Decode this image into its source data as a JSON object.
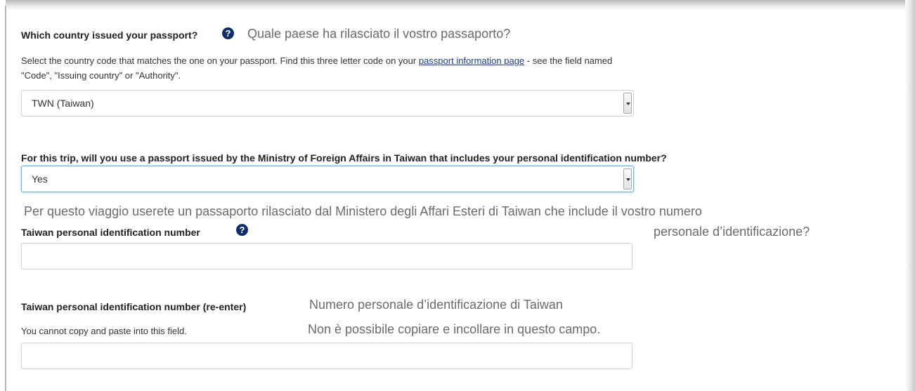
{
  "issuing_country": {
    "question": "Which country issued your passport?",
    "translation": "Quale paese ha rilasciato il vostro passaporto?",
    "help_line1_before": "Select the country code that matches the one on your passport.  Find this three letter code on your",
    "help_link": "passport information page",
    "help_line1_after": "- see the field named",
    "help_line2": "\"Code\", \"Issuing country\" or \"Authority\".",
    "selected_value": "TWN (Taiwan)",
    "help_icon": "question-circle-icon"
  },
  "mofa_passport": {
    "question": "For this trip, will you use a passport issued by the Ministry of Foreign Affairs in Taiwan that includes your personal identification number?",
    "selected_value": "Yes",
    "translation_line1": "Per questo viaggio userete un passaporto rilasciato dal Ministero degli Affari Esteri di Taiwan che include il vostro numero",
    "translation_line2": "personale d’identificazione?"
  },
  "pin": {
    "label": "Taiwan personal identification number",
    "value": "",
    "help_icon": "question-circle-icon"
  },
  "pin_reenter": {
    "label": "Taiwan personal identification number (re-enter)",
    "translation": "Numero personale d’identificazione di Taiwan",
    "help": "You cannot copy and paste into this field.",
    "help_translation": "Non è possibile copiare e incollare in questo campo.",
    "value": ""
  },
  "colors": {
    "help_icon_bg": "#0f2d6b",
    "focus_border": "#66afe9",
    "translation_text": "#6b6b6b"
  }
}
